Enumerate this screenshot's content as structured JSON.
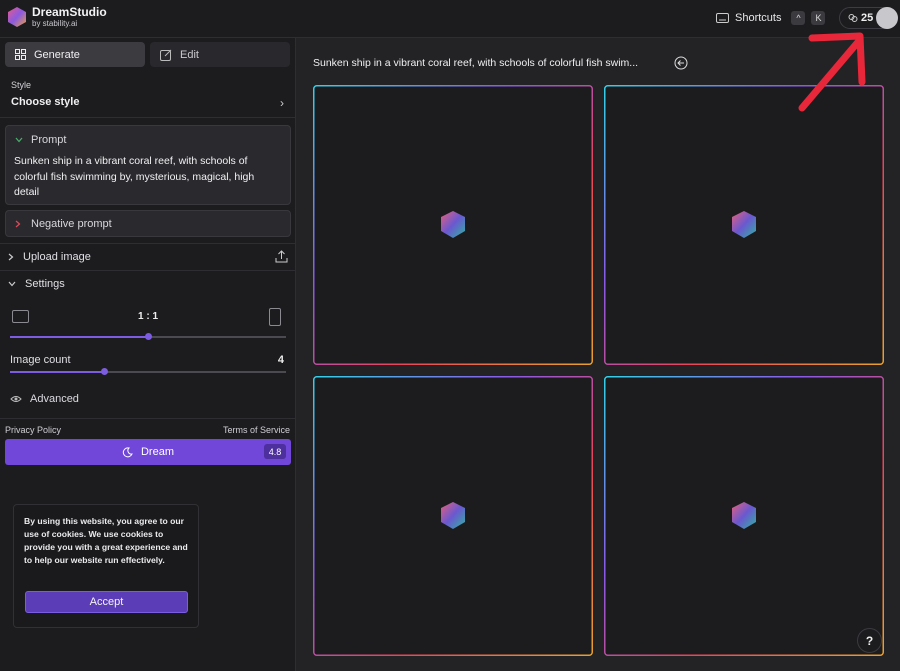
{
  "app": {
    "name": "DreamStudio",
    "byline": "by stability.ai"
  },
  "topbar": {
    "shortcuts_label": "Shortcuts",
    "key_ctrl": "^",
    "key_k": "K",
    "credits": "25"
  },
  "modes": {
    "generate": "Generate",
    "edit": "Edit"
  },
  "style": {
    "label": "Style",
    "value": "Choose style"
  },
  "prompt": {
    "label": "Prompt",
    "text": "Sunken ship in a vibrant coral reef, with schools of colorful fish swimming by, mysterious, magical, high detail",
    "negative_label": "Negative prompt"
  },
  "upload": {
    "label": "Upload image"
  },
  "settings": {
    "label": "Settings",
    "aspect_ratio": "1 : 1",
    "aspect_slider_fraction": 0.5,
    "image_count_label": "Image count",
    "image_count": "4",
    "image_count_fraction": 0.34,
    "advanced_label": "Advanced"
  },
  "footer": {
    "privacy": "Privacy Policy",
    "terms": "Terms of Service"
  },
  "dream": {
    "label": "Dream",
    "cost": "4.8"
  },
  "cookie": {
    "text": "By using this website, you agree to our use of cookies. We use cookies to provide you with a great experience and to help our website run effectively.",
    "accept": "Accept"
  },
  "main": {
    "title": "Sunken ship in a vibrant coral reef, with schools of colorful fish swim...",
    "help": "?"
  },
  "colors": {
    "accent": "#7047d8",
    "annotation_arrow": "#e8283a"
  }
}
